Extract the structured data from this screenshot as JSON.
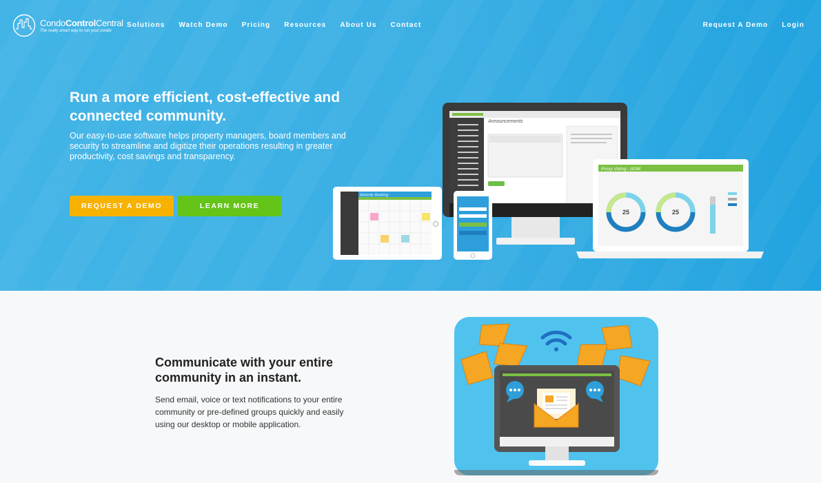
{
  "brand": {
    "name_light": "Condo",
    "name_bold": "Control",
    "name_end": "Central",
    "tagline": "The really smart way to run your condo"
  },
  "nav": {
    "items": [
      "Solutions",
      "Watch Demo",
      "Pricing",
      "Resources",
      "About Us",
      "Contact"
    ],
    "request_demo": "Request A Demo",
    "login": "Login"
  },
  "hero": {
    "title": "Run a more efficient, cost-effective and connected community.",
    "subtitle": "Our easy-to-use software helps property managers, board members and security to streamline and digitize their operations resulting in greater productivity, cost savings and transparency.",
    "cta_demo": "REQUEST A DEMO",
    "cta_more": "LEARN MORE"
  },
  "devices": {
    "desktop_screen_title": "Announcements",
    "tablet_screen_title": "Amenity Booking",
    "laptop_screen_title": "Proxy Voting - AGM",
    "donut_1_value": "25",
    "donut_2_value": "25"
  },
  "feature": {
    "title": "Communicate with your entire community in an instant.",
    "body": "Send email, voice or text notifications to your entire community or pre-defined groups quickly and easily using our desktop or mobile application."
  },
  "colors": {
    "hero_bg": "#3aafe4",
    "demo_button": "#f7b200",
    "learn_more_button": "#64c417",
    "illustration_bg": "#4fc3ee",
    "envelope": "#f5a623"
  }
}
